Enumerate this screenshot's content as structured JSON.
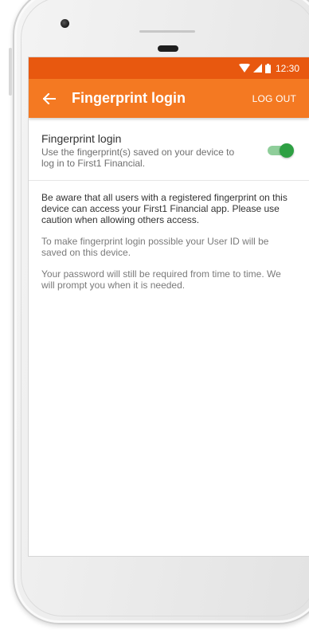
{
  "status_bar": {
    "time": "12:30",
    "icons": [
      "wifi-icon",
      "signal-icon",
      "battery-icon"
    ]
  },
  "app_bar": {
    "back_icon": "arrow-left-icon",
    "title": "Fingerprint login",
    "logout_label": "LOG OUT"
  },
  "setting": {
    "title": "Fingerprint login",
    "description": "Use the fingerprint(s) saved on your device to log in to First1 Financial.",
    "toggle_on": true
  },
  "info": {
    "warning": "Be aware that all users with a registered fingerprint on this device can access your First1 Financial app. Please use caution when allowing others access.",
    "user_id_note": "To make fingerprint login possible your User ID will be saved on this device.",
    "password_note": "Your password will still be required from time to time. We will prompt you when it is needed."
  },
  "colors": {
    "status_bar": "#e8580f",
    "app_bar": "#f47922",
    "toggle_on": "#2ea043"
  }
}
